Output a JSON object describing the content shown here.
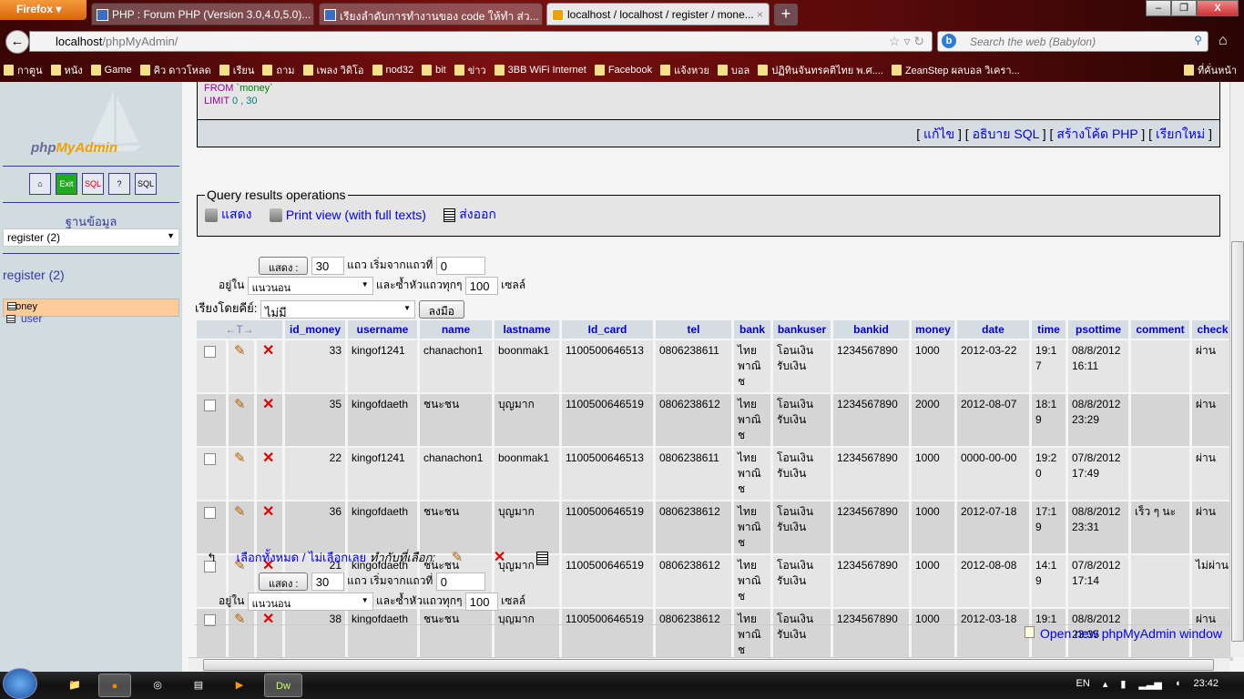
{
  "browser": {
    "menu_label": "Firefox ▾",
    "tabs": [
      {
        "title": "PHP : Forum PHP (Version 3.0,4.0,5.0)..."
      },
      {
        "title": "เรียงลำดับการทำงานของ code ให้ทำ ส่ว..."
      },
      {
        "title": "localhost / localhost / register / mone..."
      }
    ],
    "new_tab": "+",
    "url_host": "localhost",
    "url_path": "/phpMyAdmin/",
    "search_placeholder": "Search the web (Babylon)",
    "bookmarks": [
      "กาตูน",
      "หนัง",
      "Game",
      "คิว ดาวโหลด",
      "เรียน",
      "ถาม",
      "เพลง วิดิโอ",
      "nod32",
      "bit",
      "ข่าว",
      "3BB WiFi Internet",
      "Facebook",
      "แจ้งหวย",
      "บอล",
      "ปฏิทินจันทรคติไทย พ.ศ....",
      "ZeanStep ผลบอล วิเครา...",
      "ที่คั่นหน้า"
    ]
  },
  "sidebar": {
    "logo": "phpMyAdmin",
    "logo_php": "php",
    "logo_rest": "MyAdmin",
    "icons": [
      "home-icon",
      "exit-icon",
      "sql-window-icon",
      "help-icon",
      "sql-docs-icon"
    ],
    "db_label": "ฐานข้อมูล",
    "db_selected": "register (2)",
    "db_name": "register (2)",
    "tables": [
      "money",
      "user"
    ]
  },
  "sql": {
    "line1_kw": "FROM",
    "line1_val": "`money`",
    "line2_kw": "LIMIT",
    "line2_val": "0 , 30",
    "links": [
      "แก้ไข",
      "อธิบาย SQL",
      "สร้างโค้ด PHP",
      "เรียกใหม่"
    ]
  },
  "ops": {
    "legend": "Query results operations",
    "print": "แสดง",
    "print_full": "Print view (with full texts)",
    "export": "ส่งออก"
  },
  "nav": {
    "show_btn": "แสดง :",
    "rows": "30",
    "rows_label": "แถว เริ่มจากแถวที่",
    "start": "0",
    "in_label": "อยู่ใน",
    "mode": "แนวนอน",
    "repeat_label": "และซ้ำหัวแถวทุกๆ",
    "repeat": "100",
    "cells_label": "เซลล์",
    "sort_label": "เรียงโดยคีย์:",
    "sort_value": "ไม่มี",
    "go_btn": "ลงมือ"
  },
  "table": {
    "columns": [
      "id_money",
      "username",
      "name",
      "lastname",
      "Id_card",
      "tel",
      "bank",
      "bankuser",
      "bankid",
      "money",
      "date",
      "time",
      "psottime",
      "comment",
      "check"
    ],
    "rows": [
      [
        "33",
        "kingof1241",
        "chanachon1",
        "boonmak1",
        "1100500646513",
        "0806238611",
        "ไทย พาณิช",
        "โอนเงิน รับเงิน",
        "1234567890",
        "1000",
        "2012-03-22",
        "19:17",
        "08/8/2012 16:11",
        "",
        "ผ่าน"
      ],
      [
        "35",
        "kingofdaeth",
        "ชนะชน",
        "บุญมาก",
        "1100500646519",
        "0806238612",
        "ไทย พาณิช",
        "โอนเงิน รับเงิน",
        "1234567890",
        "2000",
        "2012-08-07",
        "18:19",
        "08/8/2012 23:29",
        "",
        "ผ่าน"
      ],
      [
        "22",
        "kingof1241",
        "chanachon1",
        "boonmak1",
        "1100500646513",
        "0806238611",
        "ไทย พาณิช",
        "โอนเงิน รับเงิน",
        "1234567890",
        "1000",
        "0000-00-00",
        "19:20",
        "07/8/2012 17:49",
        "",
        "ผ่าน"
      ],
      [
        "36",
        "kingofdaeth",
        "ชนะชน",
        "บุญมาก",
        "1100500646519",
        "0806238612",
        "ไทย พาณิช",
        "โอนเงิน รับเงิน",
        "1234567890",
        "1000",
        "2012-07-18",
        "17:19",
        "08/8/2012 23:31",
        "เร็ว ๆ นะ",
        "ผ่าน"
      ],
      [
        "21",
        "kingofdaeth",
        "ชนะชน",
        "บุญมาก",
        "1100500646519",
        "0806238612",
        "ไทย พาณิช",
        "โอนเงิน รับเงิน",
        "1234567890",
        "1000",
        "2012-08-08",
        "14:19",
        "07/8/2012 17:14",
        "",
        "ไม่ผ่าน"
      ],
      [
        "38",
        "kingofdaeth",
        "ชนะชน",
        "บุญมาก",
        "1100500646519",
        "0806238612",
        "ไทย พาณิช",
        "โอนเงิน รับเงิน",
        "1234567890",
        "1000",
        "2012-03-18",
        "19:1",
        "08/8/2012 23:35",
        "",
        "ผ่าน"
      ]
    ]
  },
  "bottom": {
    "select_all": "เลือกทั้งหมด / ไม่เลือกเลย",
    "with_selected": "ทำกับที่เลือก:",
    "open_window": "Open new phpMyAdmin window"
  },
  "taskbar": {
    "lang": "EN",
    "clock": "23:42"
  }
}
